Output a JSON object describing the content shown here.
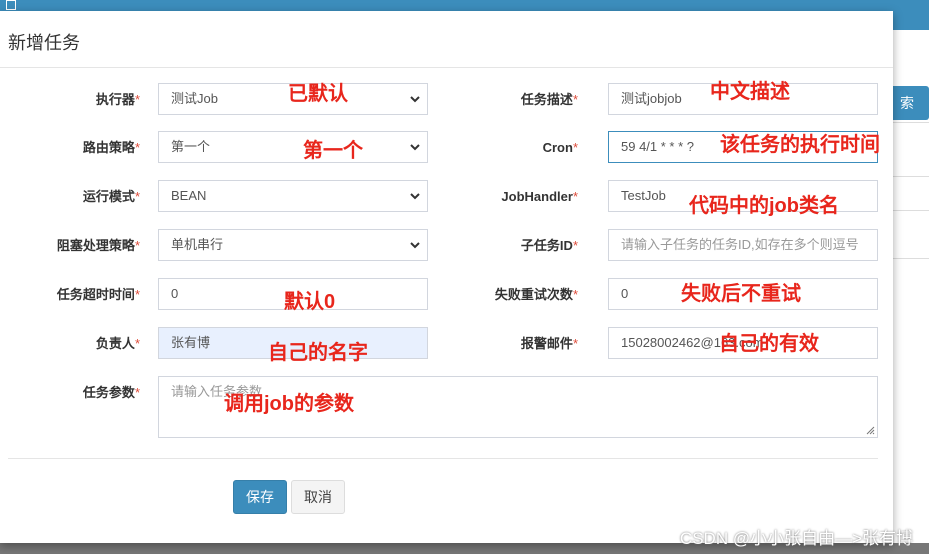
{
  "background": {
    "search_button_label": "索"
  },
  "modal": {
    "title": "新增任务"
  },
  "form": {
    "executor": {
      "label": "执行器",
      "required_mark": "*",
      "value": "测试Job"
    },
    "job_desc": {
      "label": "任务描述",
      "required_mark": "*",
      "value": "测试jobjob"
    },
    "route_strategy": {
      "label": "路由策略",
      "required_mark": "*",
      "value": "第一个"
    },
    "cron": {
      "label": "Cron",
      "required_mark": "*",
      "value": "59 4/1 * * * ?"
    },
    "glue_type": {
      "label": "运行模式",
      "required_mark": "*",
      "value": "BEAN"
    },
    "job_handler": {
      "label": "JobHandler",
      "required_mark": "*",
      "value": "TestJob"
    },
    "block_strategy": {
      "label": "阻塞处理策略",
      "required_mark": "*",
      "value": "单机串行"
    },
    "child_job_id": {
      "label": "子任务ID",
      "required_mark": "*",
      "placeholder": "请输入子任务的任务ID,如存在多个则逗号"
    },
    "timeout": {
      "label": "任务超时时间",
      "required_mark": "*",
      "value": "0"
    },
    "fail_retry": {
      "label": "失败重试次数",
      "required_mark": "*",
      "value": "0"
    },
    "author": {
      "label": "负责人",
      "required_mark": "*",
      "value": "张有博"
    },
    "alarm_email": {
      "label": "报警邮件",
      "required_mark": "*",
      "value": "15028002462@163.com"
    },
    "executor_param": {
      "label": "任务参数",
      "required_mark": "*",
      "placeholder": "请输入任务参数"
    }
  },
  "buttons": {
    "save": "保存",
    "cancel": "取消"
  },
  "annotations": {
    "executor": "已默认",
    "job_desc": "中文描述",
    "route_strategy": "第一个",
    "cron": "该任务的执行时间",
    "job_handler": "代码中的job类名",
    "timeout": "默认0",
    "fail_retry": "失败后不重试",
    "author": "自己的名字",
    "alarm_email": "自己的有效",
    "executor_param": "调用job的参数"
  },
  "watermark": "CSDN @小小张自由—>张有博",
  "colors": {
    "primary": "#3c8dbc",
    "annotation": "#e8261c",
    "required": "#dd4b39"
  }
}
